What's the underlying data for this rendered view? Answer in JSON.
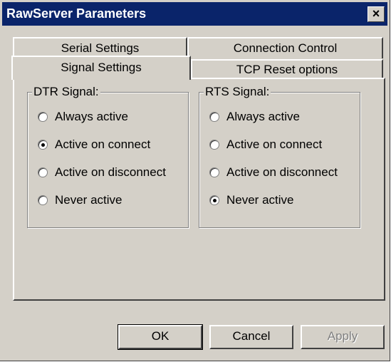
{
  "window": {
    "title": "RawServer Parameters",
    "close_glyph": "×"
  },
  "tabs": {
    "back_row": [
      "Serial Settings",
      "Connection Control"
    ],
    "front_row": [
      "Signal Settings",
      "TCP Reset options"
    ],
    "active": "Signal Settings"
  },
  "dtr": {
    "label": "DTR Signal:",
    "options": [
      "Always active",
      "Active on connect",
      "Active on disconnect",
      "Never active"
    ],
    "selected": "Active on connect"
  },
  "rts": {
    "label": "RTS Signal:",
    "options": [
      "Always active",
      "Active on connect",
      "Active on disconnect",
      "Never active"
    ],
    "selected": "Never active"
  },
  "buttons": {
    "ok": "OK",
    "cancel": "Cancel",
    "apply": "Apply"
  }
}
